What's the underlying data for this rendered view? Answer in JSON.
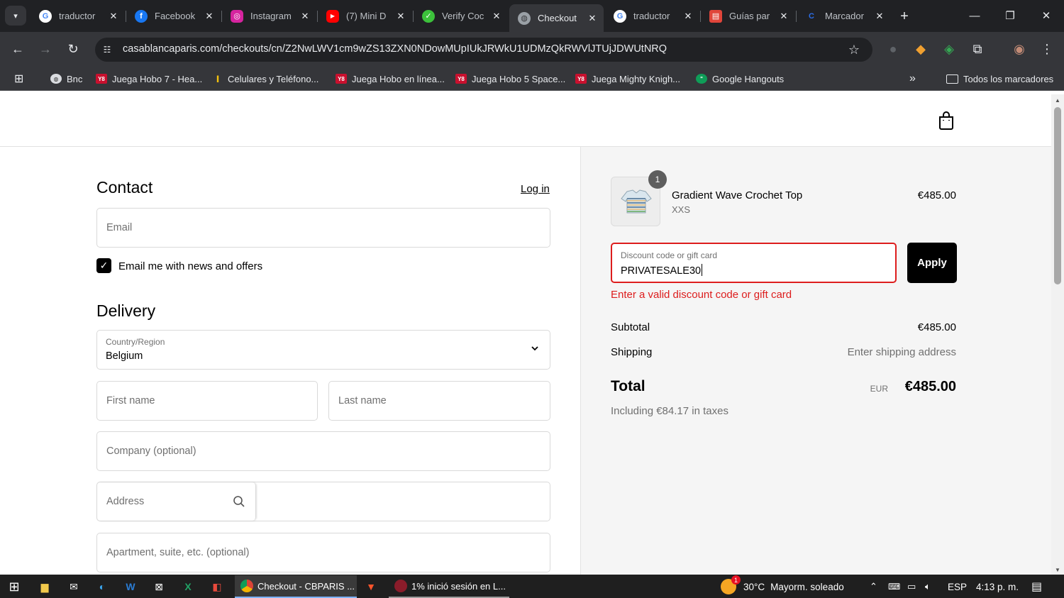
{
  "browser": {
    "tabs": [
      {
        "title": "traductor",
        "favicon": "google-icon",
        "color": "#ffffff"
      },
      {
        "title": "Facebook",
        "favicon": "facebook-icon",
        "color": "#1877f2"
      },
      {
        "title": "Instagram",
        "favicon": "instagram-icon",
        "color": "#d6249f"
      },
      {
        "title": "(7) Mini D",
        "favicon": "youtube-icon",
        "color": "#ff0000"
      },
      {
        "title": "Verify Coc",
        "favicon": "verify-icon",
        "color": "#3cc13b"
      },
      {
        "title": "Checkout",
        "favicon": "globe-icon",
        "color": "#9aa0a6",
        "active": true
      },
      {
        "title": "traductor",
        "favicon": "google-icon",
        "color": "#ffffff"
      },
      {
        "title": "Guías par",
        "favicon": "guide-icon",
        "color": "#e0453a"
      },
      {
        "title": "Marcador",
        "favicon": "marcador-icon",
        "color": "#2b6de8"
      }
    ],
    "url": "casablancaparis.com/checkouts/cn/Z2NwLWV1cm9wZS13ZXN0NDowMUpIUkJRWkU1UDMzQkRWVlJTUjJDWUtNRQ",
    "bookmarks": [
      {
        "label": "Bnc"
      },
      {
        "label": "Juega Hobo 7 - Hea..."
      },
      {
        "label": "Celulares y Teléfono..."
      },
      {
        "label": "Juega Hobo en línea..."
      },
      {
        "label": "Juega Hobo 5 Space..."
      },
      {
        "label": "Juega Mighty Knigh..."
      },
      {
        "label": "Google Hangouts"
      }
    ],
    "all_bookmarks": "Todos los marcadores",
    "overflow": "»"
  },
  "checkout": {
    "contact_heading": "Contact",
    "login_link": "Log in",
    "email_placeholder": "Email",
    "newsletter_label": "Email me with news and offers",
    "newsletter_checked": true,
    "delivery_heading": "Delivery",
    "country_label": "Country/Region",
    "country_value": "Belgium",
    "first_name_placeholder": "First name",
    "last_name_placeholder": "Last name",
    "company_placeholder": "Company (optional)",
    "address_placeholder": "Address",
    "apartment_placeholder": "Apartment, suite, etc. (optional)"
  },
  "summary": {
    "item": {
      "name": "Gradient Wave Crochet Top",
      "variant": "XXS",
      "price": "€485.00",
      "quantity": "1"
    },
    "discount_label": "Discount code or gift card",
    "discount_value": "PRIVATESALE30",
    "apply_label": "Apply",
    "error_message": "Enter a valid discount code or gift card",
    "subtotal_label": "Subtotal",
    "subtotal_value": "€485.00",
    "shipping_label": "Shipping",
    "shipping_value": "Enter shipping address",
    "total_label": "Total",
    "currency": "EUR",
    "total_value": "€485.00",
    "taxes_note": "Including €84.17 in taxes",
    "error_color": "#dd1d1d"
  },
  "taskbar": {
    "apps": [
      {
        "label": "Checkout - CBPARIS ...",
        "active": true
      },
      {
        "label": "1% inició sesión en L...",
        "active": false
      }
    ],
    "weather_temp": "30°C",
    "weather_text": "Mayorm. soleado",
    "language": "ESP",
    "time": "4:13 p. m.",
    "notification_badge": "1"
  }
}
